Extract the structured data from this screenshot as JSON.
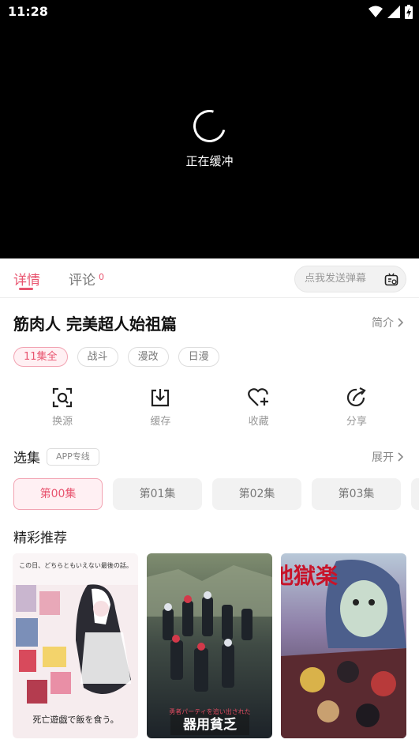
{
  "status_bar": {
    "time": "11:28"
  },
  "player": {
    "buffering_text": "正在缓冲"
  },
  "tabs": {
    "detail": "详情",
    "comment": "评论",
    "comment_count": "0"
  },
  "danmaku": {
    "placeholder": "点我发送弹幕"
  },
  "show": {
    "title": "筋肉人 完美超人始祖篇",
    "intro_label": "简介",
    "tags": [
      "11集全",
      "战斗",
      "漫改",
      "日漫"
    ]
  },
  "actions": [
    {
      "label": "换源",
      "icon": "switch-source-icon"
    },
    {
      "label": "缓存",
      "icon": "download-icon"
    },
    {
      "label": "收藏",
      "icon": "favorite-add-icon"
    },
    {
      "label": "分享",
      "icon": "share-icon"
    }
  ],
  "episodes": {
    "title": "选集",
    "badge": "APP专线",
    "expand_label": "展开",
    "items": [
      "第00集",
      "第01集",
      "第02集",
      "第03集"
    ]
  },
  "recommendations": {
    "title": "精彩推荐",
    "posters": [
      {
        "caption": "死亡遊戯で飯を食う。"
      },
      {
        "caption": "器用貧乏"
      },
      {
        "caption": "地獄楽"
      }
    ]
  },
  "colors": {
    "accent": "#e8546f",
    "accent_bg": "#fff0f3",
    "video_bg": "#000000"
  }
}
